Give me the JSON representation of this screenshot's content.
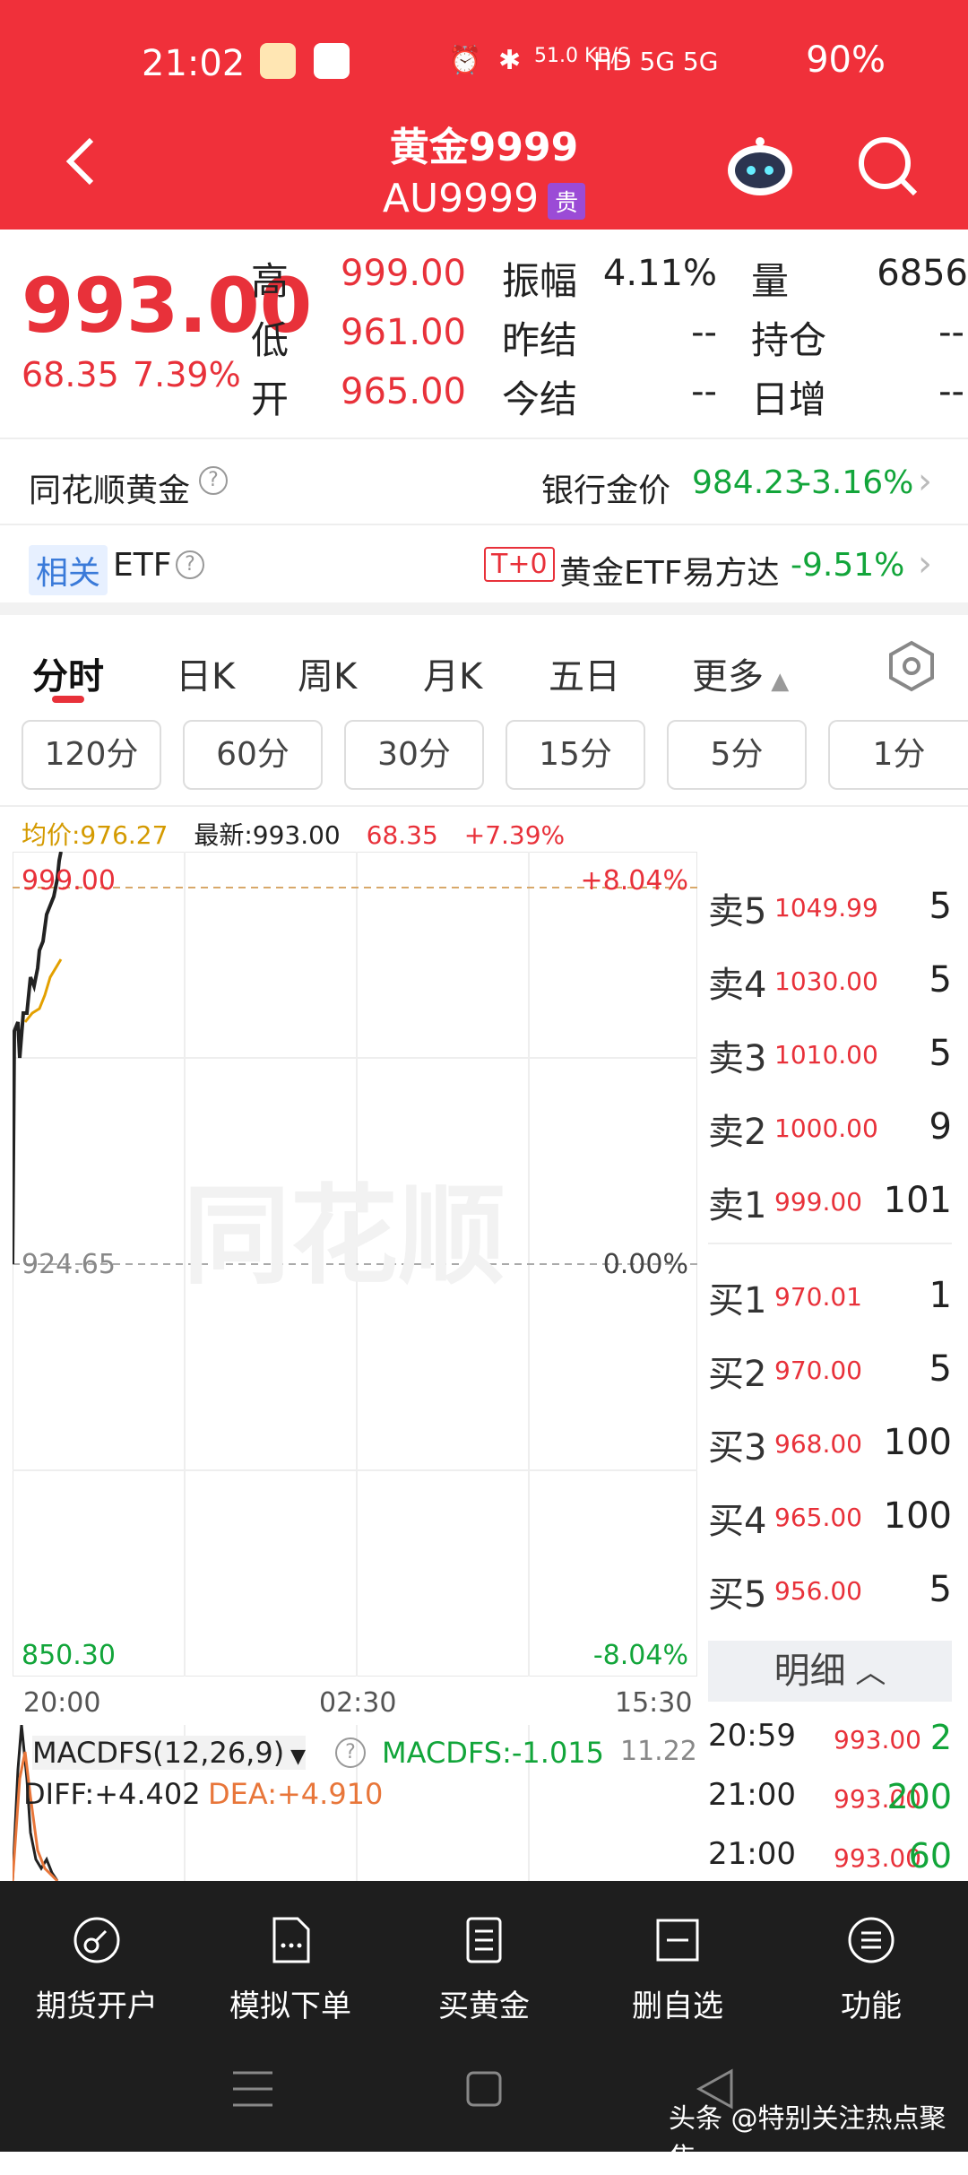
{
  "status": {
    "time": "21:02",
    "network": "51.0 KB/S",
    "signals": "HD 5G 5G",
    "battery": "90%"
  },
  "header": {
    "title": "黄金9999",
    "code": "AU9999",
    "tag": "贵"
  },
  "quote": {
    "price": "993.00",
    "change": "68.35",
    "change_pct": "7.39%",
    "high_label": "高",
    "high": "999.00",
    "low_label": "低",
    "low": "961.00",
    "open_label": "开",
    "open": "965.00",
    "amp_label": "振幅",
    "amp": "4.11%",
    "prev_settle_label": "昨结",
    "prev_settle": "--",
    "today_settle_label": "今结",
    "today_settle": "--",
    "vol_label": "量",
    "vol": "6856",
    "pos_label": "持仓",
    "pos": "--",
    "day_inc_label": "日增",
    "day_inc": "--"
  },
  "bank_row": {
    "name": "同花顺黄金",
    "label": "银行金价",
    "price": "984.23",
    "pct": "-3.16%"
  },
  "etf_row": {
    "tag": "相关",
    "name": "ETF",
    "t0": "T+0",
    "fund": "黄金ETF易方达",
    "pct": "-9.51%"
  },
  "tabs": [
    "分时",
    "日K",
    "周K",
    "月K",
    "五日",
    "更多"
  ],
  "periods": [
    "120分",
    "60分",
    "30分",
    "15分",
    "5分",
    "1分"
  ],
  "chart_info": {
    "avg": "均价:976.27",
    "latest": "最新:993.00",
    "chg": "68.35",
    "pct": "+7.39%"
  },
  "chart": {
    "top_price": "999.00",
    "top_pct": "+8.04%",
    "mid_price": "924.65",
    "mid_pct": "0.00%",
    "bot_price": "850.30",
    "bot_pct": "-8.04%",
    "t_start": "20:00",
    "t_mid": "02:30",
    "t_end": "15:30",
    "watermark": "同花顺",
    "macd_title": "MACDFS(12,26,9)",
    "macd_value": "MACDFS:-1.015",
    "macd_top": "11.22",
    "diff": "DIFF:+4.402",
    "dea": "DEA:+4.910"
  },
  "orderbook": [
    {
      "label": "卖5",
      "price": "1049.99",
      "vol": "5"
    },
    {
      "label": "卖4",
      "price": "1030.00",
      "vol": "5"
    },
    {
      "label": "卖3",
      "price": "1010.00",
      "vol": "5"
    },
    {
      "label": "卖2",
      "price": "1000.00",
      "vol": "9"
    },
    {
      "label": "卖1",
      "price": "999.00",
      "vol": "101"
    },
    {
      "label": "买1",
      "price": "970.01",
      "vol": "1"
    },
    {
      "label": "买2",
      "price": "970.00",
      "vol": "5"
    },
    {
      "label": "买3",
      "price": "968.00",
      "vol": "100"
    },
    {
      "label": "买4",
      "price": "965.00",
      "vol": "100"
    },
    {
      "label": "买5",
      "price": "956.00",
      "vol": "5"
    }
  ],
  "detail_label": "明细",
  "ticks": [
    {
      "time": "20:59",
      "price": "993.00",
      "vol": "2"
    },
    {
      "time": "21:00",
      "price": "993.00",
      "vol": "200"
    },
    {
      "time": "21:00",
      "price": "993.00",
      "vol": "60"
    }
  ],
  "bottom_nav": [
    "期货开户",
    "模拟下单",
    "买黄金",
    "删自选",
    "功能"
  ],
  "watermark_text": "头条 @特别关注热点聚焦",
  "colors": {
    "brand": "#f0303a",
    "up": "#e8313a",
    "down": "#12a53a"
  }
}
